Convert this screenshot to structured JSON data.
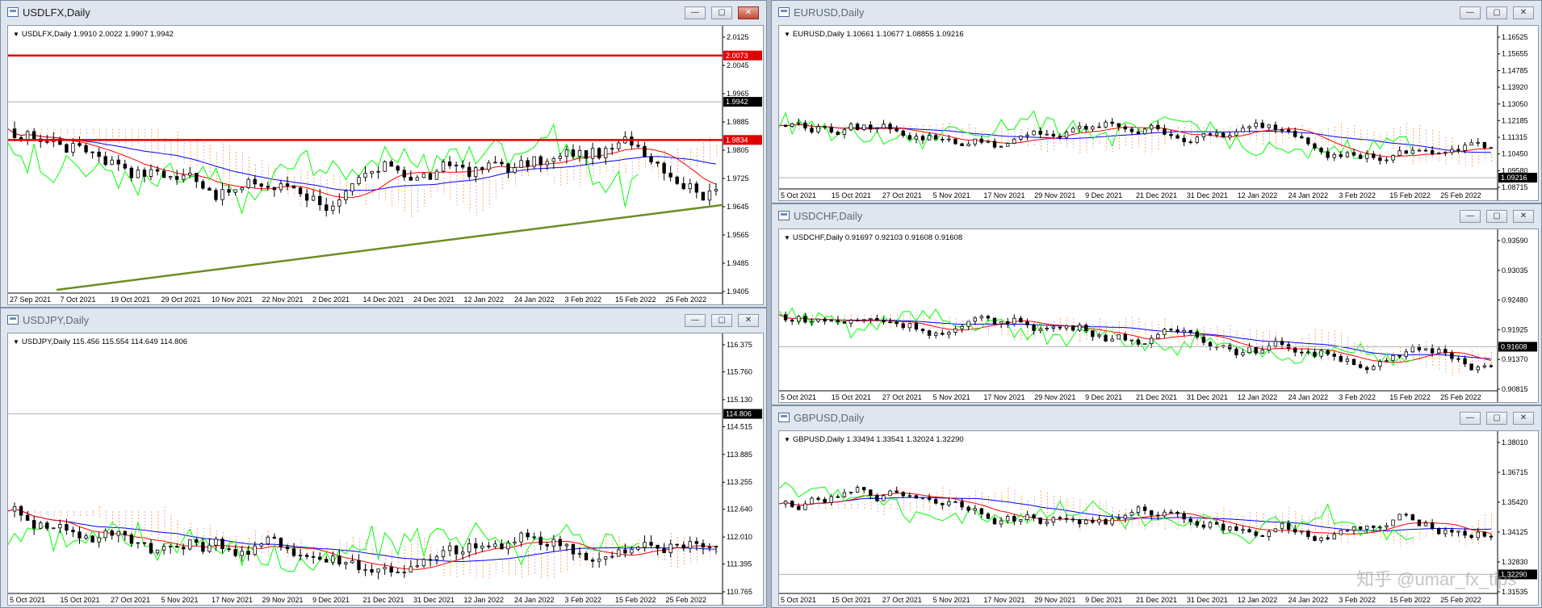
{
  "windows": [
    {
      "id": "usdlfx",
      "title": "USDLFX,Daily",
      "active": true,
      "header": "USDLFX,Daily  1.9910 2.0022 1.9907 1.9942",
      "price_levels": [
        "2.0125",
        "2.0045",
        "1.9965",
        "1.9885",
        "1.9805",
        "1.9725",
        "1.9645",
        "1.9565",
        "1.9485",
        "1.9405"
      ],
      "date_labels": [
        "27 Sep 2021",
        "7 Oct 2021",
        "19 Oct 2021",
        "29 Oct 2021",
        "10 Nov 2021",
        "22 Nov 2021",
        "2 Dec 2021",
        "14 Dec 2021",
        "24 Dec 2021",
        "12 Jan 2022",
        "24 Jan 2022",
        "3 Feb 2022",
        "15 Feb 2022",
        "25 Feb 2022"
      ],
      "current_price": "1.9942",
      "levels": [
        {
          "value": "2.0073"
        },
        {
          "value": "1.9834"
        }
      ]
    },
    {
      "id": "usdjpy",
      "title": "USDJPY,Daily",
      "active": false,
      "header": "USDJPY,Daily  115.456 115.554 114.649 114.806",
      "price_levels": [
        "116.375",
        "115.760",
        "115.130",
        "114.515",
        "113.885",
        "113.255",
        "112.640",
        "112.010",
        "111.395",
        "110.765"
      ],
      "date_labels": [
        "5 Oct 2021",
        "15 Oct 2021",
        "27 Oct 2021",
        "5 Nov 2021",
        "17 Nov 2021",
        "29 Nov 2021",
        "9 Dec 2021",
        "21 Dec 2021",
        "31 Dec 2021",
        "12 Jan 2022",
        "24 Jan 2022",
        "3 Feb 2022",
        "15 Feb 2022",
        "25 Feb 2022"
      ],
      "current_price": "114.806"
    },
    {
      "id": "eurusd",
      "title": "EURUSD,Daily",
      "active": false,
      "header": "EURUSD,Daily  1.10661 1.10677 1.08855 1.09216",
      "price_levels": [
        "1.16525",
        "1.15655",
        "1.14785",
        "1.13920",
        "1.13050",
        "1.12185",
        "1.11315",
        "1.10450",
        "1.09580",
        "1.08715"
      ],
      "date_labels": [
        "5 Oct 2021",
        "15 Oct 2021",
        "27 Oct 2021",
        "5 Nov 2021",
        "17 Nov 2021",
        "29 Nov 2021",
        "9 Dec 2021",
        "21 Dec 2021",
        "31 Dec 2021",
        "12 Jan 2022",
        "24 Jan 2022",
        "3 Feb 2022",
        "15 Feb 2022",
        "25 Feb 2022"
      ],
      "current_price": "1.09216"
    },
    {
      "id": "usdchf",
      "title": "USDCHF,Daily",
      "active": false,
      "header": "USDCHF,Daily  0.91697 0.92103 0.91608 0.91608",
      "price_levels": [
        "0.93590",
        "0.93035",
        "0.92480",
        "0.91925",
        "0.91370",
        "0.90815"
      ],
      "date_labels": [
        "5 Oct 2021",
        "15 Oct 2021",
        "27 Oct 2021",
        "5 Nov 2021",
        "17 Nov 2021",
        "29 Nov 2021",
        "9 Dec 2021",
        "21 Dec 2021",
        "31 Dec 2021",
        "12 Jan 2022",
        "24 Jan 2022",
        "3 Feb 2022",
        "15 Feb 2022",
        "25 Feb 2022"
      ],
      "current_price": "0.91608"
    },
    {
      "id": "gbpusd",
      "title": "GBPUSD,Daily",
      "active": false,
      "header": "GBPUSD,Daily  1.33494 1.33541 1.32024 1.32290",
      "price_levels": [
        "1.38010",
        "1.36715",
        "1.35420",
        "1.34125",
        "1.32830",
        "1.31535"
      ],
      "date_labels": [
        "5 Oct 2021",
        "15 Oct 2021",
        "27 Oct 2021",
        "5 Nov 2021",
        "17 Nov 2021",
        "29 Nov 2021",
        "9 Dec 2021",
        "21 Dec 2021",
        "31 Dec 2021",
        "12 Jan 2022",
        "24 Jan 2022",
        "3 Feb 2022",
        "15 Feb 2022",
        "25 Feb 2022"
      ],
      "current_price": "1.32290"
    }
  ],
  "window_buttons": {
    "minimize": "—",
    "maximize": "▢",
    "close": "✕"
  },
  "watermark": "知乎 @umar_fx_tips",
  "colors": {
    "tenkan": "#ff0000",
    "kijun": "#0000ff",
    "chikou": "#00ff00",
    "cloud": "#ff8c3a",
    "cloud_bear": "#c4a0c8",
    "level_line": "#e00000",
    "trendline": "#6b8e23",
    "candle": "#000000"
  }
}
